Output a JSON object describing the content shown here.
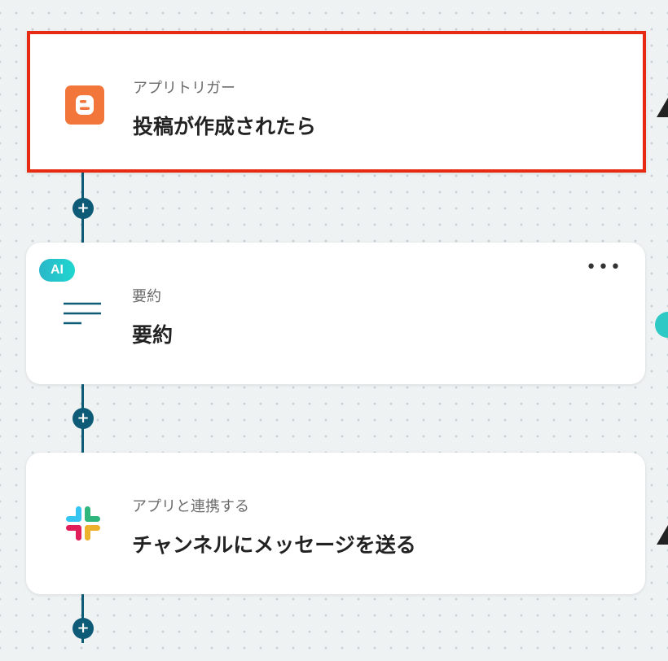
{
  "steps": [
    {
      "caption": "アプリトリガー",
      "title": "投稿が作成されたら",
      "icon": "blogger-icon",
      "selected": true
    },
    {
      "badge": "AI",
      "caption": "要約",
      "title": "要約",
      "icon": "summary-lines-icon",
      "more_label": "•••"
    },
    {
      "caption": "アプリと連携する",
      "title": "チャンネルにメッセージを送る",
      "icon": "slack-icon"
    }
  ],
  "add_step_label": "+",
  "colors": {
    "connector": "#0e5b77",
    "selected_border": "#e62b12",
    "blogger": "#f2753a",
    "ai_badge": "#2ab7c9"
  }
}
